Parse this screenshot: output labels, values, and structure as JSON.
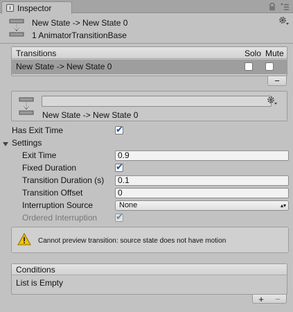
{
  "tab": {
    "label": "Inspector",
    "icon": "inspector-icon"
  },
  "window_controls": {
    "lock_icon": "lock-icon",
    "menu_icon": "menu-icon"
  },
  "header": {
    "title": "New State -> New State 0",
    "subtitle": "1 AnimatorTransitionBase",
    "icon": "transition-icon",
    "settings_icon": "gear-icon"
  },
  "transitions_list": {
    "header": "Transitions",
    "solo_label": "Solo",
    "mute_label": "Mute",
    "rows": [
      {
        "label": "New State -> New State 0",
        "solo": false,
        "mute": false
      }
    ],
    "remove_button": "−"
  },
  "transition": {
    "name_value": "",
    "label": "New State -> New State 0",
    "icon": "transition-icon",
    "settings_icon": "gear-icon"
  },
  "has_exit_time": {
    "label": "Has Exit Time",
    "checked": true
  },
  "settings": {
    "label": "Settings",
    "expanded": true,
    "exit_time": {
      "label": "Exit Time",
      "value": "0.9"
    },
    "fixed_duration": {
      "label": "Fixed Duration",
      "checked": true
    },
    "transition_duration": {
      "label": "Transition Duration (s)",
      "value": "0.1"
    },
    "transition_offset": {
      "label": "Transition Offset",
      "value": "0"
    },
    "interruption_source": {
      "label": "Interruption Source",
      "selected": "None"
    },
    "ordered_interruption": {
      "label": "Ordered Interruption",
      "checked": true,
      "enabled": false
    }
  },
  "warning": {
    "text": "Cannot preview transition: source state does not have motion",
    "icon": "warning-icon"
  },
  "conditions": {
    "header": "Conditions",
    "empty_text": "List is Empty",
    "add_button": "+",
    "remove_button": "−"
  },
  "colors": {
    "panel_bg": "#c2c2c2",
    "selected_row": "#9e9e9e",
    "checkbox_check": "#1a4f9c",
    "warning_yellow": "#f2c200"
  }
}
